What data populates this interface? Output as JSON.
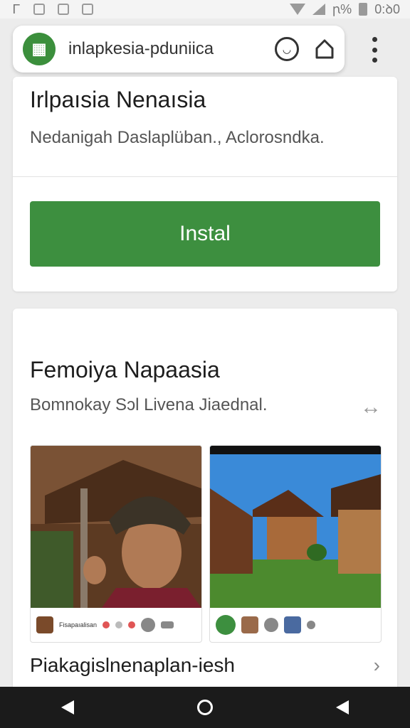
{
  "status_bar": {
    "left_text": "Ꮁ",
    "battery_text": "ꞃ%",
    "time": "0:ꝺ0"
  },
  "browser": {
    "url": "inlapkesia-pduniica"
  },
  "top_card": {
    "title": "Irlpaısia Nenaısia",
    "subtitle": "Nedanigah Daslaplüban., Aclorosndka.",
    "install_label": "Instal"
  },
  "main_card": {
    "title": "Femoiya Napaasia",
    "subtitle": "Bomnokay Sɔl  Livena Jiaednal.",
    "screenshot_1": {
      "caption": "Fisapaıalisan"
    },
    "bottom_title": "Piakagislnenaplan-iesh"
  },
  "colors": {
    "accent": "#3d8f3f",
    "nav_bar": "#1b1b1b"
  }
}
